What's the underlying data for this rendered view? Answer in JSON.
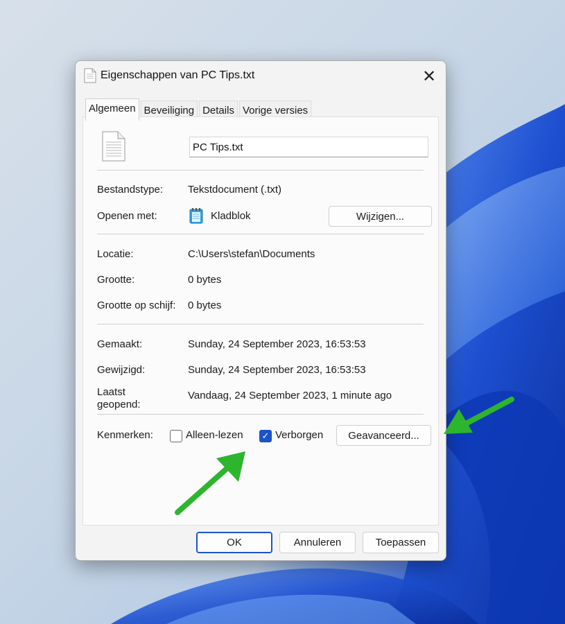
{
  "dialog": {
    "title": "Eigenschappen van PC Tips.txt",
    "close_label": "✕"
  },
  "tabs": [
    {
      "label": "Algemeen",
      "active": true
    },
    {
      "label": "Beveiliging",
      "active": false
    },
    {
      "label": "Details",
      "active": false
    },
    {
      "label": "Vorige versies",
      "active": false
    }
  ],
  "general": {
    "filename": "PC Tips.txt",
    "file_type_label": "Bestandstype:",
    "file_type_value": "Tekstdocument (.txt)",
    "open_with_label": "Openen met:",
    "open_with_value": "Kladblok",
    "change_button": "Wijzigen...",
    "location_label": "Locatie:",
    "location_value": "C:\\Users\\stefan\\Documents",
    "size_label": "Grootte:",
    "size_value": "0 bytes",
    "size_on_disk_label": "Grootte op schijf:",
    "size_on_disk_value": "0 bytes",
    "created_label": "Gemaakt:",
    "created_value": "Sunday, 24 September 2023, 16:53:53",
    "modified_label": "Gewijzigd:",
    "modified_value": "Sunday, 24 September 2023, 16:53:53",
    "accessed_label_1": "Laatst",
    "accessed_label_2": "geopend:",
    "accessed_value": "Vandaag, 24 September 2023, 1 minute ago",
    "attributes_label": "Kenmerken:",
    "readonly_label": "Alleen-lezen",
    "readonly_checked": false,
    "hidden_label": "Verborgen",
    "hidden_checked": true,
    "advanced_button": "Geavanceerd..."
  },
  "footer": {
    "ok": "OK",
    "cancel": "Annuleren",
    "apply": "Toepassen"
  },
  "colors": {
    "accent": "#1b53c8",
    "annotation_arrow": "#2db52d"
  },
  "icons": [
    "text-file-icon",
    "close-icon",
    "notepad-icon",
    "checkmark-icon",
    "green-arrow-icon"
  ]
}
